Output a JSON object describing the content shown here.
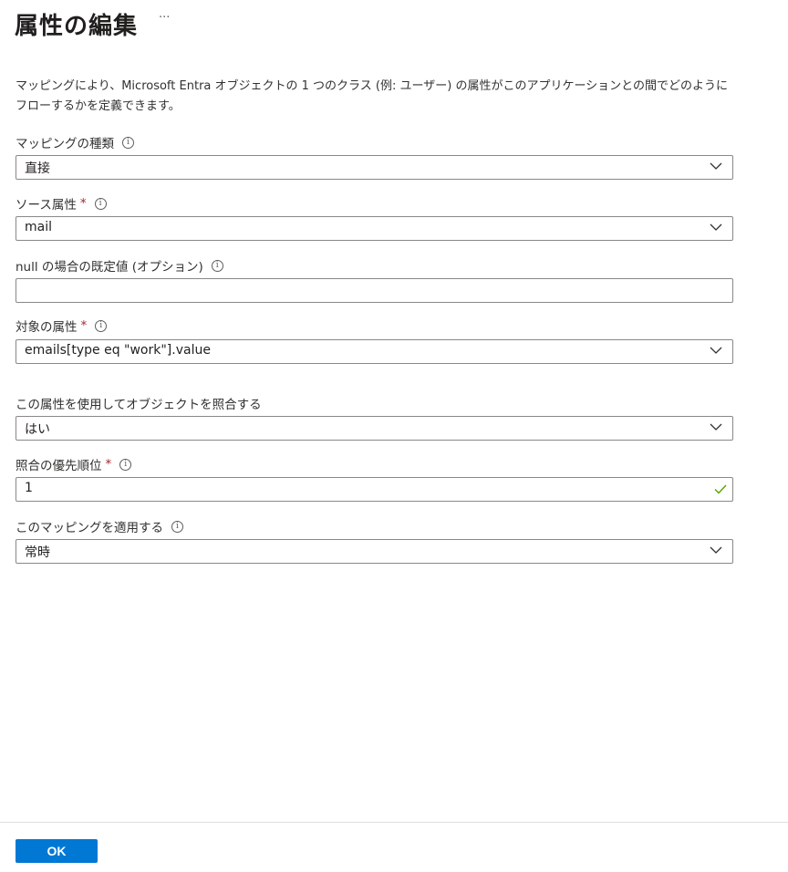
{
  "header": {
    "title": "属性の編集",
    "more_label": "···"
  },
  "description": "マッピングにより、Microsoft Entra オブジェクトの 1 つのクラス (例: ユーザー) の属性がこのアプリケーションとの間でどのようにフローするかを定義できます。",
  "fields": {
    "mapping_type": {
      "label": "マッピングの種類",
      "value": "直接"
    },
    "source_attribute": {
      "label": "ソース属性",
      "required": "*",
      "value": "mail"
    },
    "default_value": {
      "label": "null の場合の既定値 (オプション)",
      "value": ""
    },
    "target_attribute": {
      "label": "対象の属性",
      "required": "*",
      "value": "emails[type eq \"work\"].value"
    },
    "match_objects": {
      "label": "この属性を使用してオブジェクトを照合する",
      "value": "はい"
    },
    "match_priority": {
      "label": "照合の優先順位",
      "required": "*",
      "value": "1"
    },
    "apply_mapping": {
      "label": "このマッピングを適用する",
      "value": "常時"
    }
  },
  "footer": {
    "ok_label": "OK"
  },
  "colors": {
    "primary": "#0078d4",
    "required": "#a4262c",
    "valid_check": "#57a300"
  }
}
